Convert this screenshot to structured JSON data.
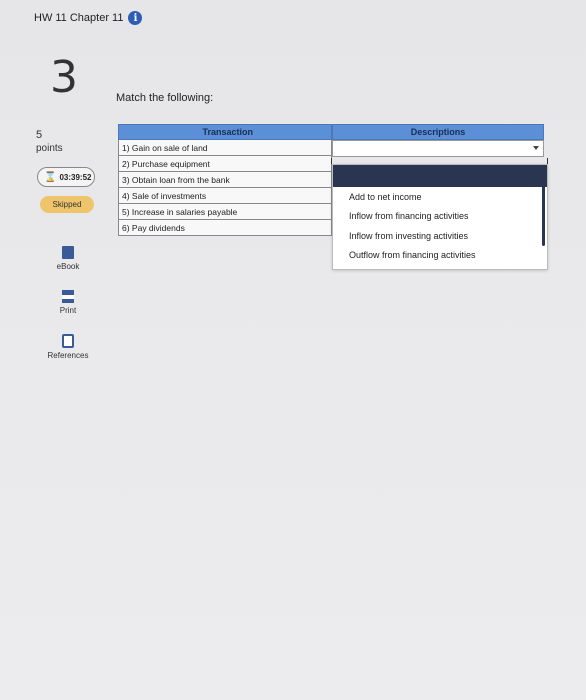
{
  "header": {
    "title": "HW 11 Chapter 11",
    "info_icon": "info-icon"
  },
  "question": {
    "number": "3",
    "prompt": "Match the following:",
    "points_value": "5",
    "points_label": "points",
    "timer": "03:39:52",
    "status": "Skipped"
  },
  "tools": [
    {
      "label": "eBook",
      "icon": "book-icon"
    },
    {
      "label": "Print",
      "icon": "printer-icon"
    },
    {
      "label": "References",
      "icon": "references-icon"
    }
  ],
  "table": {
    "header_transaction": "Transaction",
    "header_descriptions": "Descriptions",
    "rows": [
      "1) Gain on sale of land",
      "2) Purchase equipment",
      "3) Obtain loan from the bank",
      "4) Sale of investments",
      "5) Increase in salaries payable",
      "6) Pay dividends"
    ]
  },
  "dropdown": {
    "options": [
      "Add to net income",
      "Inflow from financing activities",
      "Inflow from investing activities",
      "Outflow from financing activities"
    ]
  },
  "colors": {
    "header_blue": "#5b8fd6",
    "skipped_badge": "#efc56b",
    "dropdown_selected": "#2a3552"
  }
}
